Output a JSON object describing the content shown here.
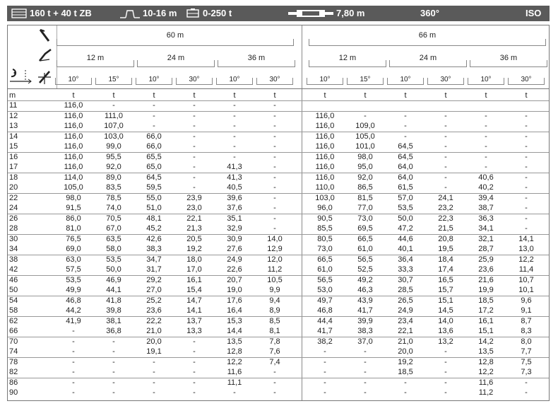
{
  "topbar": {
    "capacity": "160 t + 40 t ZB",
    "outrigger": "10-16 m",
    "counterweight": "0-250 t",
    "base": "7,80 m",
    "rotation": "360°",
    "standard": "ISO"
  },
  "header": {
    "left": {
      "main_boom": "60 m",
      "jibs": [
        "12 m",
        "24 m",
        "36 m"
      ],
      "angles": [
        "10°",
        "15°",
        "10°",
        "30°",
        "10°",
        "30°"
      ]
    },
    "right": {
      "main_boom": "66 m",
      "jibs": [
        "12 m",
        "24 m",
        "36 m"
      ],
      "angles": [
        "10°",
        "15°",
        "10°",
        "30°",
        "10°",
        "30°"
      ]
    }
  },
  "units": {
    "radius": "m",
    "load": "t"
  },
  "table": {
    "rows": [
      [
        "11",
        "116,0",
        "-",
        "-",
        "-",
        "-",
        "-",
        "",
        "",
        "",
        "",
        "",
        ""
      ],
      [
        "12",
        "116,0",
        "111,0",
        "-",
        "-",
        "-",
        "-",
        "116,0",
        "-",
        "-",
        "-",
        "-",
        "-"
      ],
      [
        "13",
        "116,0",
        "107,0",
        "-",
        "-",
        "-",
        "-",
        "116,0",
        "109,0",
        "-",
        "-",
        "-",
        "-"
      ],
      [
        "14",
        "116,0",
        "103,0",
        "66,0",
        "-",
        "-",
        "-",
        "116,0",
        "105,0",
        "-",
        "-",
        "-",
        "-"
      ],
      [
        "15",
        "116,0",
        "99,0",
        "66,0",
        "-",
        "-",
        "-",
        "116,0",
        "101,0",
        "64,5",
        "-",
        "-",
        "-"
      ],
      [
        "16",
        "116,0",
        "95,5",
        "65,5",
        "-",
        "-",
        "-",
        "116,0",
        "98,0",
        "64,5",
        "-",
        "-",
        "-"
      ],
      [
        "17",
        "116,0",
        "92,0",
        "65,0",
        "-",
        "41,3",
        "-",
        "116,0",
        "95,0",
        "64,0",
        "-",
        "-",
        "-"
      ],
      [
        "18",
        "114,0",
        "89,0",
        "64,5",
        "-",
        "41,3",
        "-",
        "116,0",
        "92,0",
        "64,0",
        "-",
        "40,6",
        "-"
      ],
      [
        "20",
        "105,0",
        "83,5",
        "59,5",
        "-",
        "40,5",
        "-",
        "110,0",
        "86,5",
        "61,5",
        "-",
        "40,2",
        "-"
      ],
      [
        "22",
        "98,0",
        "78,5",
        "55,0",
        "23,9",
        "39,6",
        "-",
        "103,0",
        "81,5",
        "57,0",
        "24,1",
        "39,4",
        "-"
      ],
      [
        "24",
        "91,5",
        "74,0",
        "51,0",
        "23,0",
        "37,6",
        "-",
        "96,0",
        "77,0",
        "53,5",
        "23,2",
        "38,7",
        "-"
      ],
      [
        "26",
        "86,0",
        "70,5",
        "48,1",
        "22,1",
        "35,1",
        "-",
        "90,5",
        "73,0",
        "50,0",
        "22,3",
        "36,3",
        "-"
      ],
      [
        "28",
        "81,0",
        "67,0",
        "45,2",
        "21,3",
        "32,9",
        "-",
        "85,5",
        "69,5",
        "47,2",
        "21,5",
        "34,1",
        "-"
      ],
      [
        "30",
        "76,5",
        "63,5",
        "42,6",
        "20,5",
        "30,9",
        "14,0",
        "80,5",
        "66,5",
        "44,6",
        "20,8",
        "32,1",
        "14,1"
      ],
      [
        "34",
        "69,0",
        "58,0",
        "38,3",
        "19,2",
        "27,6",
        "12,9",
        "73,0",
        "61,0",
        "40,1",
        "19,5",
        "28,7",
        "13,0"
      ],
      [
        "38",
        "63,0",
        "53,5",
        "34,7",
        "18,0",
        "24,9",
        "12,0",
        "66,5",
        "56,5",
        "36,4",
        "18,4",
        "25,9",
        "12,2"
      ],
      [
        "42",
        "57,5",
        "50,0",
        "31,7",
        "17,0",
        "22,6",
        "11,2",
        "61,0",
        "52,5",
        "33,3",
        "17,4",
        "23,6",
        "11,4"
      ],
      [
        "46",
        "53,5",
        "46,9",
        "29,2",
        "16,1",
        "20,7",
        "10,5",
        "56,5",
        "49,2",
        "30,7",
        "16,5",
        "21,6",
        "10,7"
      ],
      [
        "50",
        "49,9",
        "44,1",
        "27,0",
        "15,4",
        "19,0",
        "9,9",
        "53,0",
        "46,3",
        "28,5",
        "15,7",
        "19,9",
        "10,1"
      ],
      [
        "54",
        "46,8",
        "41,8",
        "25,2",
        "14,7",
        "17,6",
        "9,4",
        "49,7",
        "43,9",
        "26,5",
        "15,1",
        "18,5",
        "9,6"
      ],
      [
        "58",
        "44,2",
        "39,8",
        "23,6",
        "14,1",
        "16,4",
        "8,9",
        "46,8",
        "41,7",
        "24,9",
        "14,5",
        "17,2",
        "9,1"
      ],
      [
        "62",
        "41,9",
        "38,1",
        "22,2",
        "13,7",
        "15,3",
        "8,5",
        "44,4",
        "39,9",
        "23,4",
        "14,0",
        "16,1",
        "8,7"
      ],
      [
        "66",
        "-",
        "36,8",
        "21,0",
        "13,3",
        "14,4",
        "8,1",
        "41,7",
        "38,3",
        "22,1",
        "13,6",
        "15,1",
        "8,3"
      ],
      [
        "70",
        "-",
        "-",
        "20,0",
        "-",
        "13,5",
        "7,8",
        "38,2",
        "37,0",
        "21,0",
        "13,2",
        "14,2",
        "8,0"
      ],
      [
        "74",
        "-",
        "-",
        "19,1",
        "-",
        "12,8",
        "7,6",
        "-",
        "-",
        "20,0",
        "-",
        "13,5",
        "7,7"
      ],
      [
        "78",
        "-",
        "-",
        "-",
        "-",
        "12,2",
        "7,4",
        "-",
        "-",
        "19,2",
        "-",
        "12,8",
        "7,5"
      ],
      [
        "82",
        "-",
        "-",
        "-",
        "-",
        "11,6",
        "-",
        "-",
        "-",
        "18,5",
        "-",
        "12,2",
        "7,3"
      ],
      [
        "86",
        "-",
        "-",
        "-",
        "-",
        "11,1",
        "-",
        "-",
        "-",
        "-",
        "-",
        "11,6",
        "-"
      ],
      [
        "90",
        "-",
        "-",
        "-",
        "-",
        "-",
        "-",
        "-",
        "-",
        "-",
        "-",
        "11,2",
        "-"
      ]
    ]
  }
}
